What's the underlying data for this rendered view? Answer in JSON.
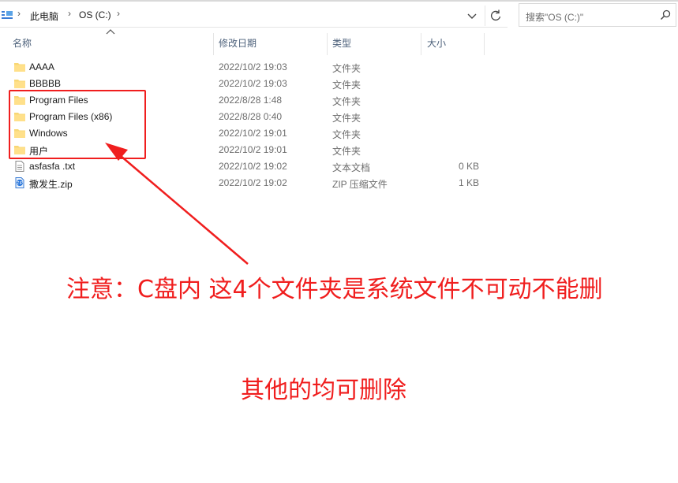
{
  "address_bar": {
    "breadcrumbs": [
      "此电脑",
      "OS (C:)"
    ],
    "search_placeholder": "搜索\"OS (C:)\""
  },
  "columns": {
    "name": "名称",
    "date": "修改日期",
    "type": "类型",
    "size": "大小"
  },
  "files": [
    {
      "name": "AAAA",
      "date": "2022/10/2 19:03",
      "type": "文件夹",
      "size": "",
      "icon": "folder-icon"
    },
    {
      "name": "BBBBB",
      "date": "2022/10/2 19:03",
      "type": "文件夹",
      "size": "",
      "icon": "folder-icon"
    },
    {
      "name": "Program Files",
      "date": "2022/8/28 1:48",
      "type": "文件夹",
      "size": "",
      "icon": "folder-icon"
    },
    {
      "name": "Program Files (x86)",
      "date": "2022/8/28 0:40",
      "type": "文件夹",
      "size": "",
      "icon": "folder-icon"
    },
    {
      "name": "Windows",
      "date": "2022/10/2 19:01",
      "type": "文件夹",
      "size": "",
      "icon": "folder-icon"
    },
    {
      "name": "用户",
      "date": "2022/10/2 19:01",
      "type": "文件夹",
      "size": "",
      "icon": "folder-icon"
    },
    {
      "name": "asfasfa .txt",
      "date": "2022/10/2 19:02",
      "type": "文本文档",
      "size": "0 KB",
      "icon": "text-file-icon"
    },
    {
      "name": "撒发生.zip",
      "date": "2022/10/2 19:02",
      "type": "ZIP 压缩文件",
      "size": "1 KB",
      "icon": "zip-file-icon"
    }
  ],
  "annotation": {
    "color": "#f01e1e",
    "note_primary": "注意：C盘内 这4个文件夹是系统文件不可动不能删",
    "note_secondary": "其他的均可删除"
  }
}
